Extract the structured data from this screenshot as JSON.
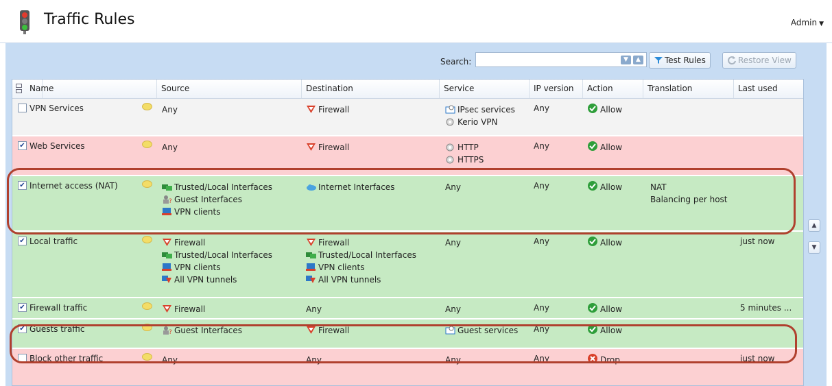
{
  "header": {
    "title": "Traffic Rules",
    "user_menu": "Admin"
  },
  "toolbar": {
    "search_label": "Search:",
    "search_value": "",
    "test_rules": "Test Rules",
    "restore_view": "Restore View"
  },
  "columns": [
    "Name",
    "Source",
    "Destination",
    "Service",
    "IP version",
    "Action",
    "Translation",
    "Last used"
  ],
  "rows": [
    {
      "name": "VPN Services",
      "checked": false,
      "source": [
        "Any"
      ],
      "destination": [
        "Firewall"
      ],
      "service": [
        "IPsec services",
        "Kerio VPN"
      ],
      "ip": "Any",
      "action": "Allow",
      "translation": [],
      "last_used": ""
    },
    {
      "name": "Web Services",
      "checked": true,
      "source": [
        "Any"
      ],
      "destination": [
        "Firewall"
      ],
      "service": [
        "HTTP",
        "HTTPS"
      ],
      "ip": "Any",
      "action": "Allow",
      "translation": [],
      "last_used": ""
    },
    {
      "name": "Internet access (NAT)",
      "checked": true,
      "source": [
        "Trusted/Local Interfaces",
        "Guest Interfaces",
        "VPN clients"
      ],
      "destination": [
        "Internet Interfaces"
      ],
      "service": [
        "Any"
      ],
      "ip": "Any",
      "action": "Allow",
      "translation": [
        "NAT",
        "Balancing per host"
      ],
      "last_used": ""
    },
    {
      "name": "Local traffic",
      "checked": true,
      "source": [
        "Firewall",
        "Trusted/Local Interfaces",
        "VPN clients",
        "All VPN tunnels"
      ],
      "destination": [
        "Firewall",
        "Trusted/Local Interfaces",
        "VPN clients",
        "All VPN tunnels"
      ],
      "service": [
        "Any"
      ],
      "ip": "Any",
      "action": "Allow",
      "translation": [],
      "last_used": "just now"
    },
    {
      "name": "Firewall traffic",
      "checked": true,
      "source": [
        "Firewall"
      ],
      "destination": [
        "Any"
      ],
      "service": [
        "Any"
      ],
      "ip": "Any",
      "action": "Allow",
      "translation": [],
      "last_used": "5 minutes ..."
    },
    {
      "name": "Guests traffic",
      "checked": true,
      "source": [
        "Guest Interfaces"
      ],
      "destination": [
        "Firewall"
      ],
      "service": [
        "Guest services"
      ],
      "ip": "Any",
      "action": "Allow",
      "translation": [],
      "last_used": ""
    },
    {
      "name": "Block other traffic",
      "checked": false,
      "source": [
        "Any"
      ],
      "destination": [
        "Any"
      ],
      "service": [
        "Any"
      ],
      "ip": "Any",
      "action": "Drop",
      "translation": [],
      "last_used": "just now"
    }
  ],
  "colors": {
    "allow_green": "#2e9e3a",
    "drop_red": "#d9412b",
    "row_red": "#fcd0d2",
    "row_green": "#c6eac3",
    "highlight_ring": "#b0402e"
  }
}
